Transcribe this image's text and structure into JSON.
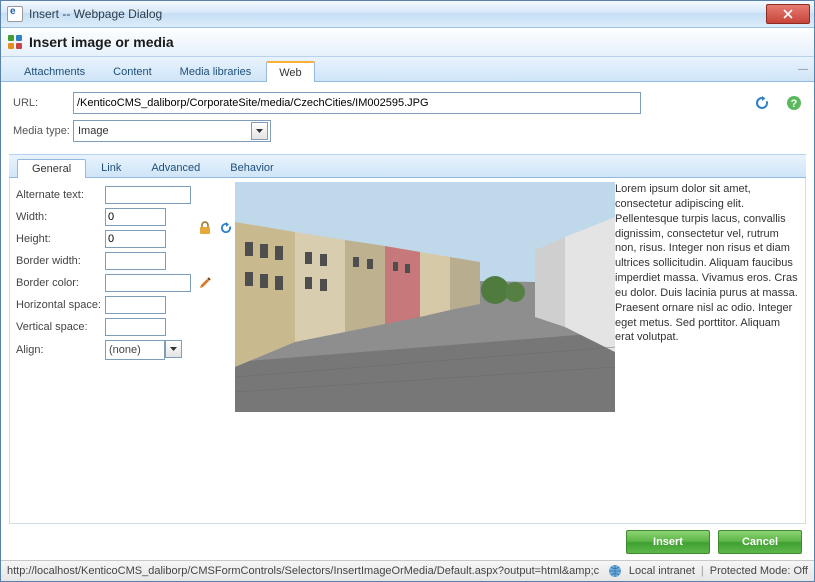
{
  "window": {
    "title": "Insert -- Webpage Dialog"
  },
  "header": {
    "heading": "Insert image or media"
  },
  "main_tabs": {
    "items": [
      "Attachments",
      "Content",
      "Media libraries",
      "Web"
    ],
    "active_index": 3
  },
  "url_section": {
    "url_label": "URL:",
    "url_value": "/KenticoCMS_daliborp/CorporateSite/media/CzechCities/IM002595.JPG",
    "media_type_label": "Media type:",
    "media_type_value": "Image"
  },
  "sub_tabs": {
    "items": [
      "General",
      "Link",
      "Advanced",
      "Behavior"
    ],
    "active_index": 0
  },
  "properties": {
    "alternate_text": {
      "label": "Alternate text:",
      "value": ""
    },
    "width": {
      "label": "Width:",
      "value": "0"
    },
    "height": {
      "label": "Height:",
      "value": "0"
    },
    "border_width": {
      "label": "Border width:",
      "value": ""
    },
    "border_color": {
      "label": "Border color:",
      "value": ""
    },
    "hspace": {
      "label": "Horizontal space:",
      "value": ""
    },
    "vspace": {
      "label": "Vertical space:",
      "value": ""
    },
    "align": {
      "label": "Align:",
      "value": "(none)"
    }
  },
  "preview": {
    "lorem": " Lorem ipsum dolor sit amet, consectetur adipiscing elit. Pellentesque turpis lacus, convallis dignissim, consectetur vel, rutrum non, risus. Integer non risus et diam ultrices sollicitudin. Aliquam faucibus imperdiet massa. Vivamus eros. Cras eu dolor. Duis lacinia purus at massa. Praesent ornare nisl ac odio. Integer eget metus. Sed porttitor. Aliquam erat volutpat."
  },
  "footer": {
    "insert": "Insert",
    "cancel": "Cancel"
  },
  "status": {
    "url": "http://localhost/KenticoCMS_daliborp/CMSFormControls/Selectors/InsertImageOrMedia/Default.aspx?output=html&amp;content=media&a",
    "zone": "Local intranet",
    "mode": "Protected Mode: Off"
  },
  "icons": {
    "refresh": "refresh-icon",
    "help": "help-icon",
    "lock": "lock-icon",
    "reset": "reset-icon",
    "colorpicker": "color-picker-icon",
    "globe": "globe-icon"
  }
}
